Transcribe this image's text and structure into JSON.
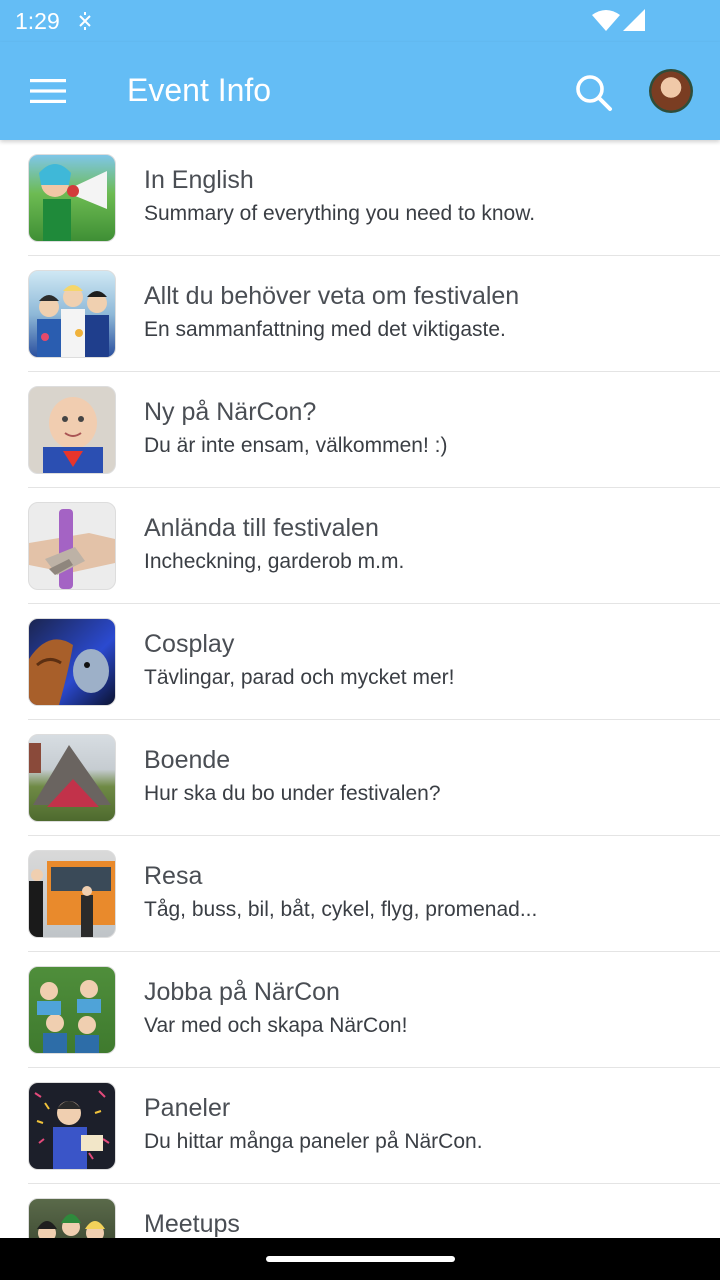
{
  "status_bar": {
    "time": "1:29",
    "icons": [
      "sync-icon",
      "wifi-icon",
      "signal-icon"
    ]
  },
  "app_bar": {
    "title": "Event Info",
    "color": "#64bdf5",
    "menu_icon": "hamburger-menu-icon",
    "search_icon": "search-icon",
    "avatar_icon": "user-avatar"
  },
  "items": [
    {
      "title": "In English",
      "subtitle": "Summary of everything you need to know."
    },
    {
      "title": "Allt du behöver veta om festivalen",
      "subtitle": "En sammanfattning med det viktigaste."
    },
    {
      "title": "Ny på NärCon?",
      "subtitle": "Du är inte ensam, välkommen! :)"
    },
    {
      "title": "Anlända till festivalen",
      "subtitle": "Incheckning, garderob m.m."
    },
    {
      "title": "Cosplay",
      "subtitle": "Tävlingar, parad och mycket mer!"
    },
    {
      "title": "Boende",
      "subtitle": "Hur ska du bo under festivalen?"
    },
    {
      "title": "Resa",
      "subtitle": "Tåg, buss, bil, båt, cykel, flyg, promenad..."
    },
    {
      "title": "Jobba på NärCon",
      "subtitle": "Var med och skapa NärCon!"
    },
    {
      "title": "Paneler",
      "subtitle": "Du hittar många paneler på NärCon."
    },
    {
      "title": "Meetups",
      "subtitle": ""
    }
  ]
}
